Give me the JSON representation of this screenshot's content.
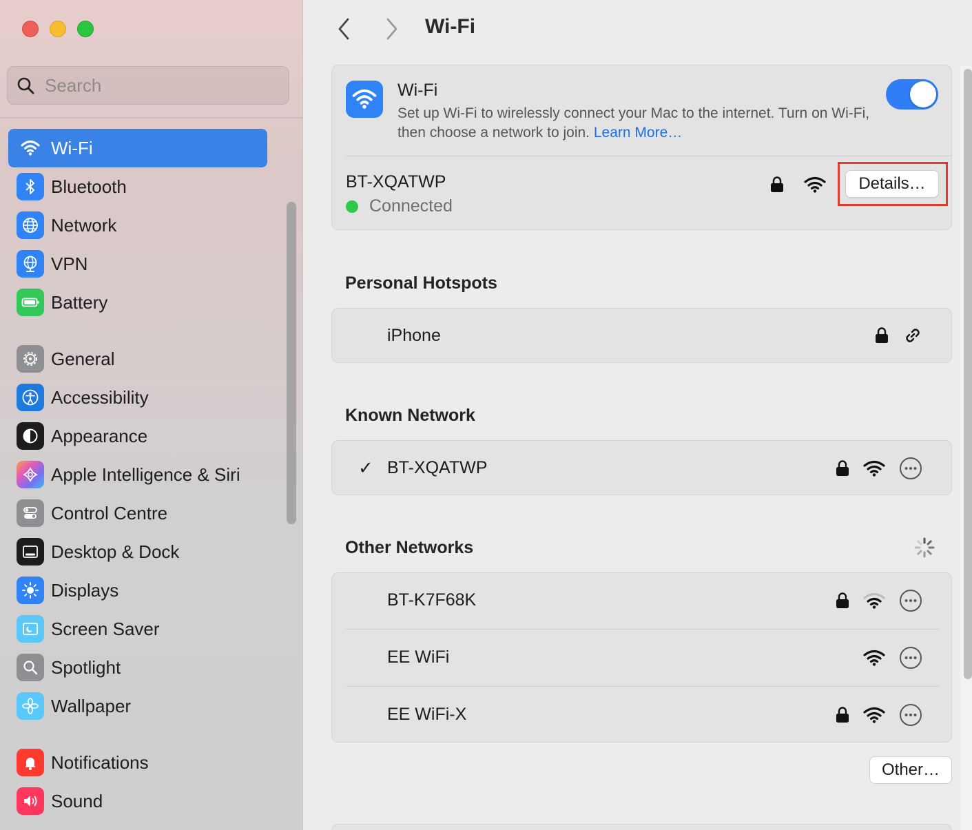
{
  "window": {
    "title": "Wi-Fi"
  },
  "search": {
    "placeholder": "Search"
  },
  "sidebar": {
    "items": [
      {
        "label": "Wi-Fi",
        "icon": "wifi-icon",
        "color": "#2f83f5"
      },
      {
        "label": "Bluetooth",
        "icon": "bluetooth-icon",
        "color": "#2f83f5"
      },
      {
        "label": "Network",
        "icon": "globe-icon",
        "color": "#2f83f5"
      },
      {
        "label": "VPN",
        "icon": "vpn-globe-icon",
        "color": "#2f83f5"
      },
      {
        "label": "Battery",
        "icon": "battery-icon",
        "color": "#34c759"
      },
      {
        "label": "General",
        "icon": "gear-icon",
        "color": "#8e8e93"
      },
      {
        "label": "Accessibility",
        "icon": "accessibility-icon",
        "color": "#1f7ae0"
      },
      {
        "label": "Appearance",
        "icon": "appearance-icon",
        "color": "#1c1c1e"
      },
      {
        "label": "Apple Intelligence & Siri",
        "icon": "siri-icon",
        "color": "#d067d8"
      },
      {
        "label": "Control Centre",
        "icon": "control-centre-icon",
        "color": "#8e8e93"
      },
      {
        "label": "Desktop & Dock",
        "icon": "dock-icon",
        "color": "#1c1c1e"
      },
      {
        "label": "Displays",
        "icon": "sun-icon",
        "color": "#2f83f5"
      },
      {
        "label": "Screen Saver",
        "icon": "screen-saver-icon",
        "color": "#5ac8fa"
      },
      {
        "label": "Spotlight",
        "icon": "magnifier-icon",
        "color": "#8e8e93"
      },
      {
        "label": "Wallpaper",
        "icon": "flower-icon",
        "color": "#5ac8fa"
      },
      {
        "label": "Notifications",
        "icon": "bell-icon",
        "color": "#ff3b30"
      },
      {
        "label": "Sound",
        "icon": "speaker-icon",
        "color": "#ff375f"
      }
    ]
  },
  "wifi": {
    "title": "Wi-Fi",
    "description": "Set up Wi-Fi to wirelessly connect your Mac to the internet. Turn on Wi-Fi, then choose a network to join.",
    "learn_more": "Learn More…",
    "enabled": true,
    "current_network": "BT-XQATWP",
    "status": "Connected",
    "details_label": "Details…"
  },
  "hotspots": {
    "title": "Personal Hotspots",
    "items": [
      {
        "name": "iPhone"
      }
    ]
  },
  "known": {
    "title": "Known Network",
    "items": [
      {
        "name": "BT-XQATWP",
        "checked": "✓"
      }
    ]
  },
  "other": {
    "title": "Other Networks",
    "items": [
      {
        "name": "BT-K7F68K",
        "locked": true
      },
      {
        "name": "EE WiFi",
        "locked": false
      },
      {
        "name": "EE WiFi-X",
        "locked": true
      }
    ],
    "other_label": "Other…"
  },
  "colors": {
    "accent": "#2f7ef5",
    "connected": "#31c748",
    "highlight": "#e03e2d"
  }
}
